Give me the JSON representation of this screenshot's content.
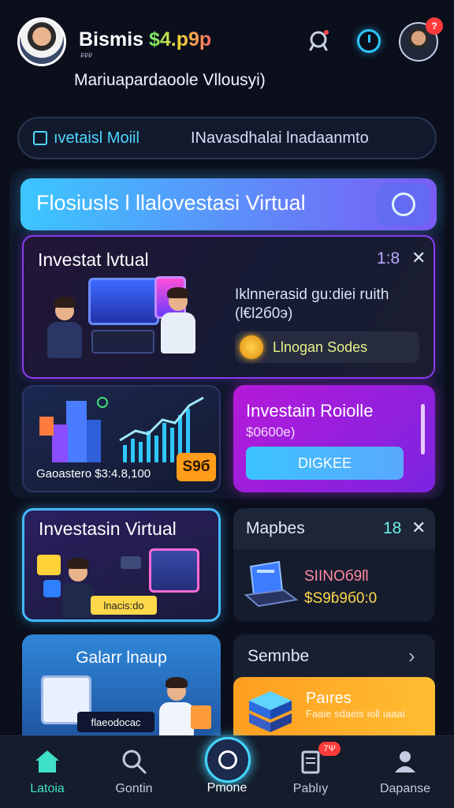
{
  "header": {
    "brand_main": "Bismis",
    "brand_accent": "$4.p9p",
    "brand_sub": "₽₽₽",
    "greeting": "Mariuapardaoole Vllousyi)",
    "notification_badge": "?"
  },
  "tabs": [
    {
      "label": "ıvetaisl Moiil",
      "active": true
    },
    {
      "label": "INavasdhalai lnadaanmto",
      "active": false
    }
  ],
  "banner": {
    "title": "Flosiusls l llalovestasi Virtual"
  },
  "feature_card": {
    "title": "Investat lvtual",
    "ratio": "1:8",
    "description": "Iklnnerasid gu:diei ruith (l€l2б0э)",
    "pill_label": "Llnogan Sodes"
  },
  "chart_card": {
    "footer": "Gaoastero $3:4.8,100",
    "price": "S9б"
  },
  "purple_card": {
    "title": "Investain Roiolle",
    "subtitle": "$0600e)",
    "button": "DIGKEE"
  },
  "virtual_card": {
    "title": "Investasin Virtual",
    "chip": "lnacis:do"
  },
  "maps_card": {
    "title": "Mapbes",
    "count": "18",
    "label": "SIINOб9ſl",
    "value": "$S9ɓ9б0:0"
  },
  "gallery_card": {
    "title": "Galarr lnaup",
    "chip": "flaeodocac"
  },
  "semnbe_card": {
    "title": "Semnbe",
    "promo_title": "Paıres",
    "promo_sub": "Faaie sdaeis ıoll ıaaai"
  },
  "nav": {
    "items": [
      {
        "label": "Latoia",
        "active": true
      },
      {
        "label": "Gontin",
        "active": false
      },
      {
        "label": "Pmone",
        "active": false
      },
      {
        "label": "Pablıy",
        "active": false
      },
      {
        "label": "Dapanse",
        "active": false
      }
    ],
    "badge": "7Ψ"
  },
  "colors": {
    "accent": "#3fe0c8",
    "primary": "#3bc7ff",
    "purple": "#b51ad8",
    "orange": "#ff9e1f"
  }
}
